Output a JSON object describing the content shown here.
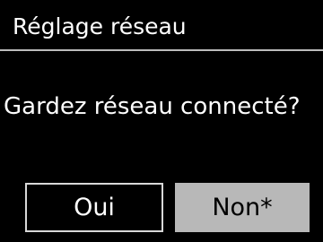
{
  "header": {
    "title": "Réglage réseau"
  },
  "main": {
    "question": "Gardez réseau connecté?"
  },
  "buttons": {
    "yes_label": "Oui",
    "no_label": "Non*"
  },
  "colors": {
    "background": "#000000",
    "text": "#ffffff",
    "divider": "#bcbcbc",
    "selected_button_bg": "#b8b8b8",
    "selected_button_text": "#000000"
  },
  "state": {
    "selected": "Non*"
  }
}
